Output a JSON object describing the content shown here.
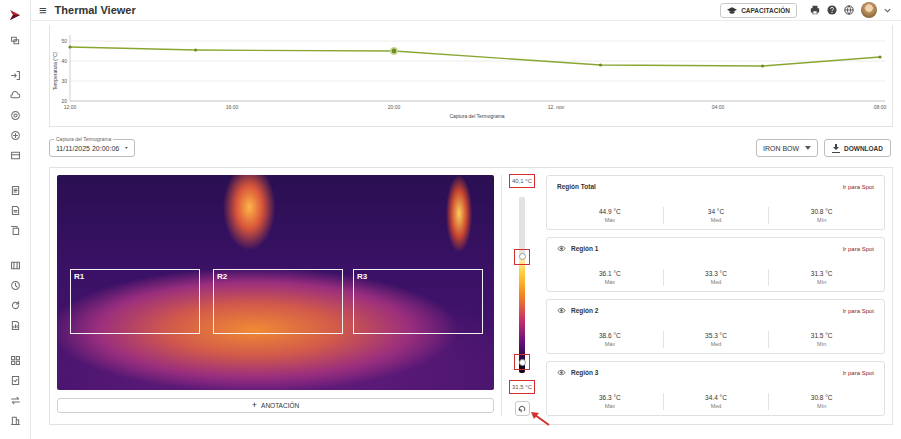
{
  "header": {
    "menu_icon": "≡",
    "title": "Thermal Viewer",
    "training_button": "CAPACITACIÓN"
  },
  "chart": {
    "y_axis_title": "Temperatura (°C)",
    "y_ticks": [
      "50",
      "40",
      "30",
      "20"
    ],
    "y_tick_values": [
      50,
      40,
      30,
      20
    ],
    "x_ticks": [
      "12:00",
      "16:00",
      "20:00",
      "12. nov",
      "04:00",
      "08:00"
    ],
    "x_tick_hours": [
      0,
      4,
      8,
      12,
      16,
      20
    ],
    "x_axis_title": "Captura del Termograma",
    "series": [
      {
        "hours": [
          0,
          3.1,
          8,
          13.1,
          17.1,
          20
        ],
        "values": [
          47,
          45.5,
          45,
          38,
          37.5,
          42
        ],
        "selected_index": 2
      }
    ]
  },
  "capture_select": {
    "label": "Captura del Termograma",
    "value": "11/11/2025 20:00:06"
  },
  "palette_select": {
    "value": "IRON BOW"
  },
  "download_button": "DOWNLOAD",
  "thermogram": {
    "regions": [
      {
        "label": "R1"
      },
      {
        "label": "R2"
      },
      {
        "label": "R3"
      }
    ],
    "annotation_icon": "+",
    "annotation_button": "ANOTACIÓN"
  },
  "scale": {
    "max": "40,1 °C",
    "min": "31,5 °C",
    "high": 0.66,
    "low": 0.06
  },
  "region_cards": [
    {
      "kind": "total",
      "name": "Región Total",
      "link": "Ir para Spot",
      "stats": [
        {
          "value": "44.9 °C",
          "label": "Máx"
        },
        {
          "value": "34 °C",
          "label": "Med"
        },
        {
          "value": "30.8 °C",
          "label": "Mín"
        }
      ]
    },
    {
      "kind": "region",
      "name": "Región 1",
      "link": "Ir para Spot",
      "stats": [
        {
          "value": "36.1 °C",
          "label": "Máx"
        },
        {
          "value": "33.3 °C",
          "label": "Med"
        },
        {
          "value": "31.3 °C",
          "label": "Mín"
        }
      ]
    },
    {
      "kind": "region",
      "name": "Región 2",
      "link": "Ir para Spot",
      "stats": [
        {
          "value": "38.6 °C",
          "label": "Máx"
        },
        {
          "value": "35.3 °C",
          "label": "Med"
        },
        {
          "value": "31.5 °C",
          "label": "Mín"
        }
      ]
    },
    {
      "kind": "region",
      "name": "Región 3",
      "link": "Ir para Spot",
      "stats": [
        {
          "value": "36.3 °C",
          "label": "Máx"
        },
        {
          "value": "34.4 °C",
          "label": "Med"
        },
        {
          "value": "30.8 °C",
          "label": "Mín"
        }
      ]
    }
  ]
}
